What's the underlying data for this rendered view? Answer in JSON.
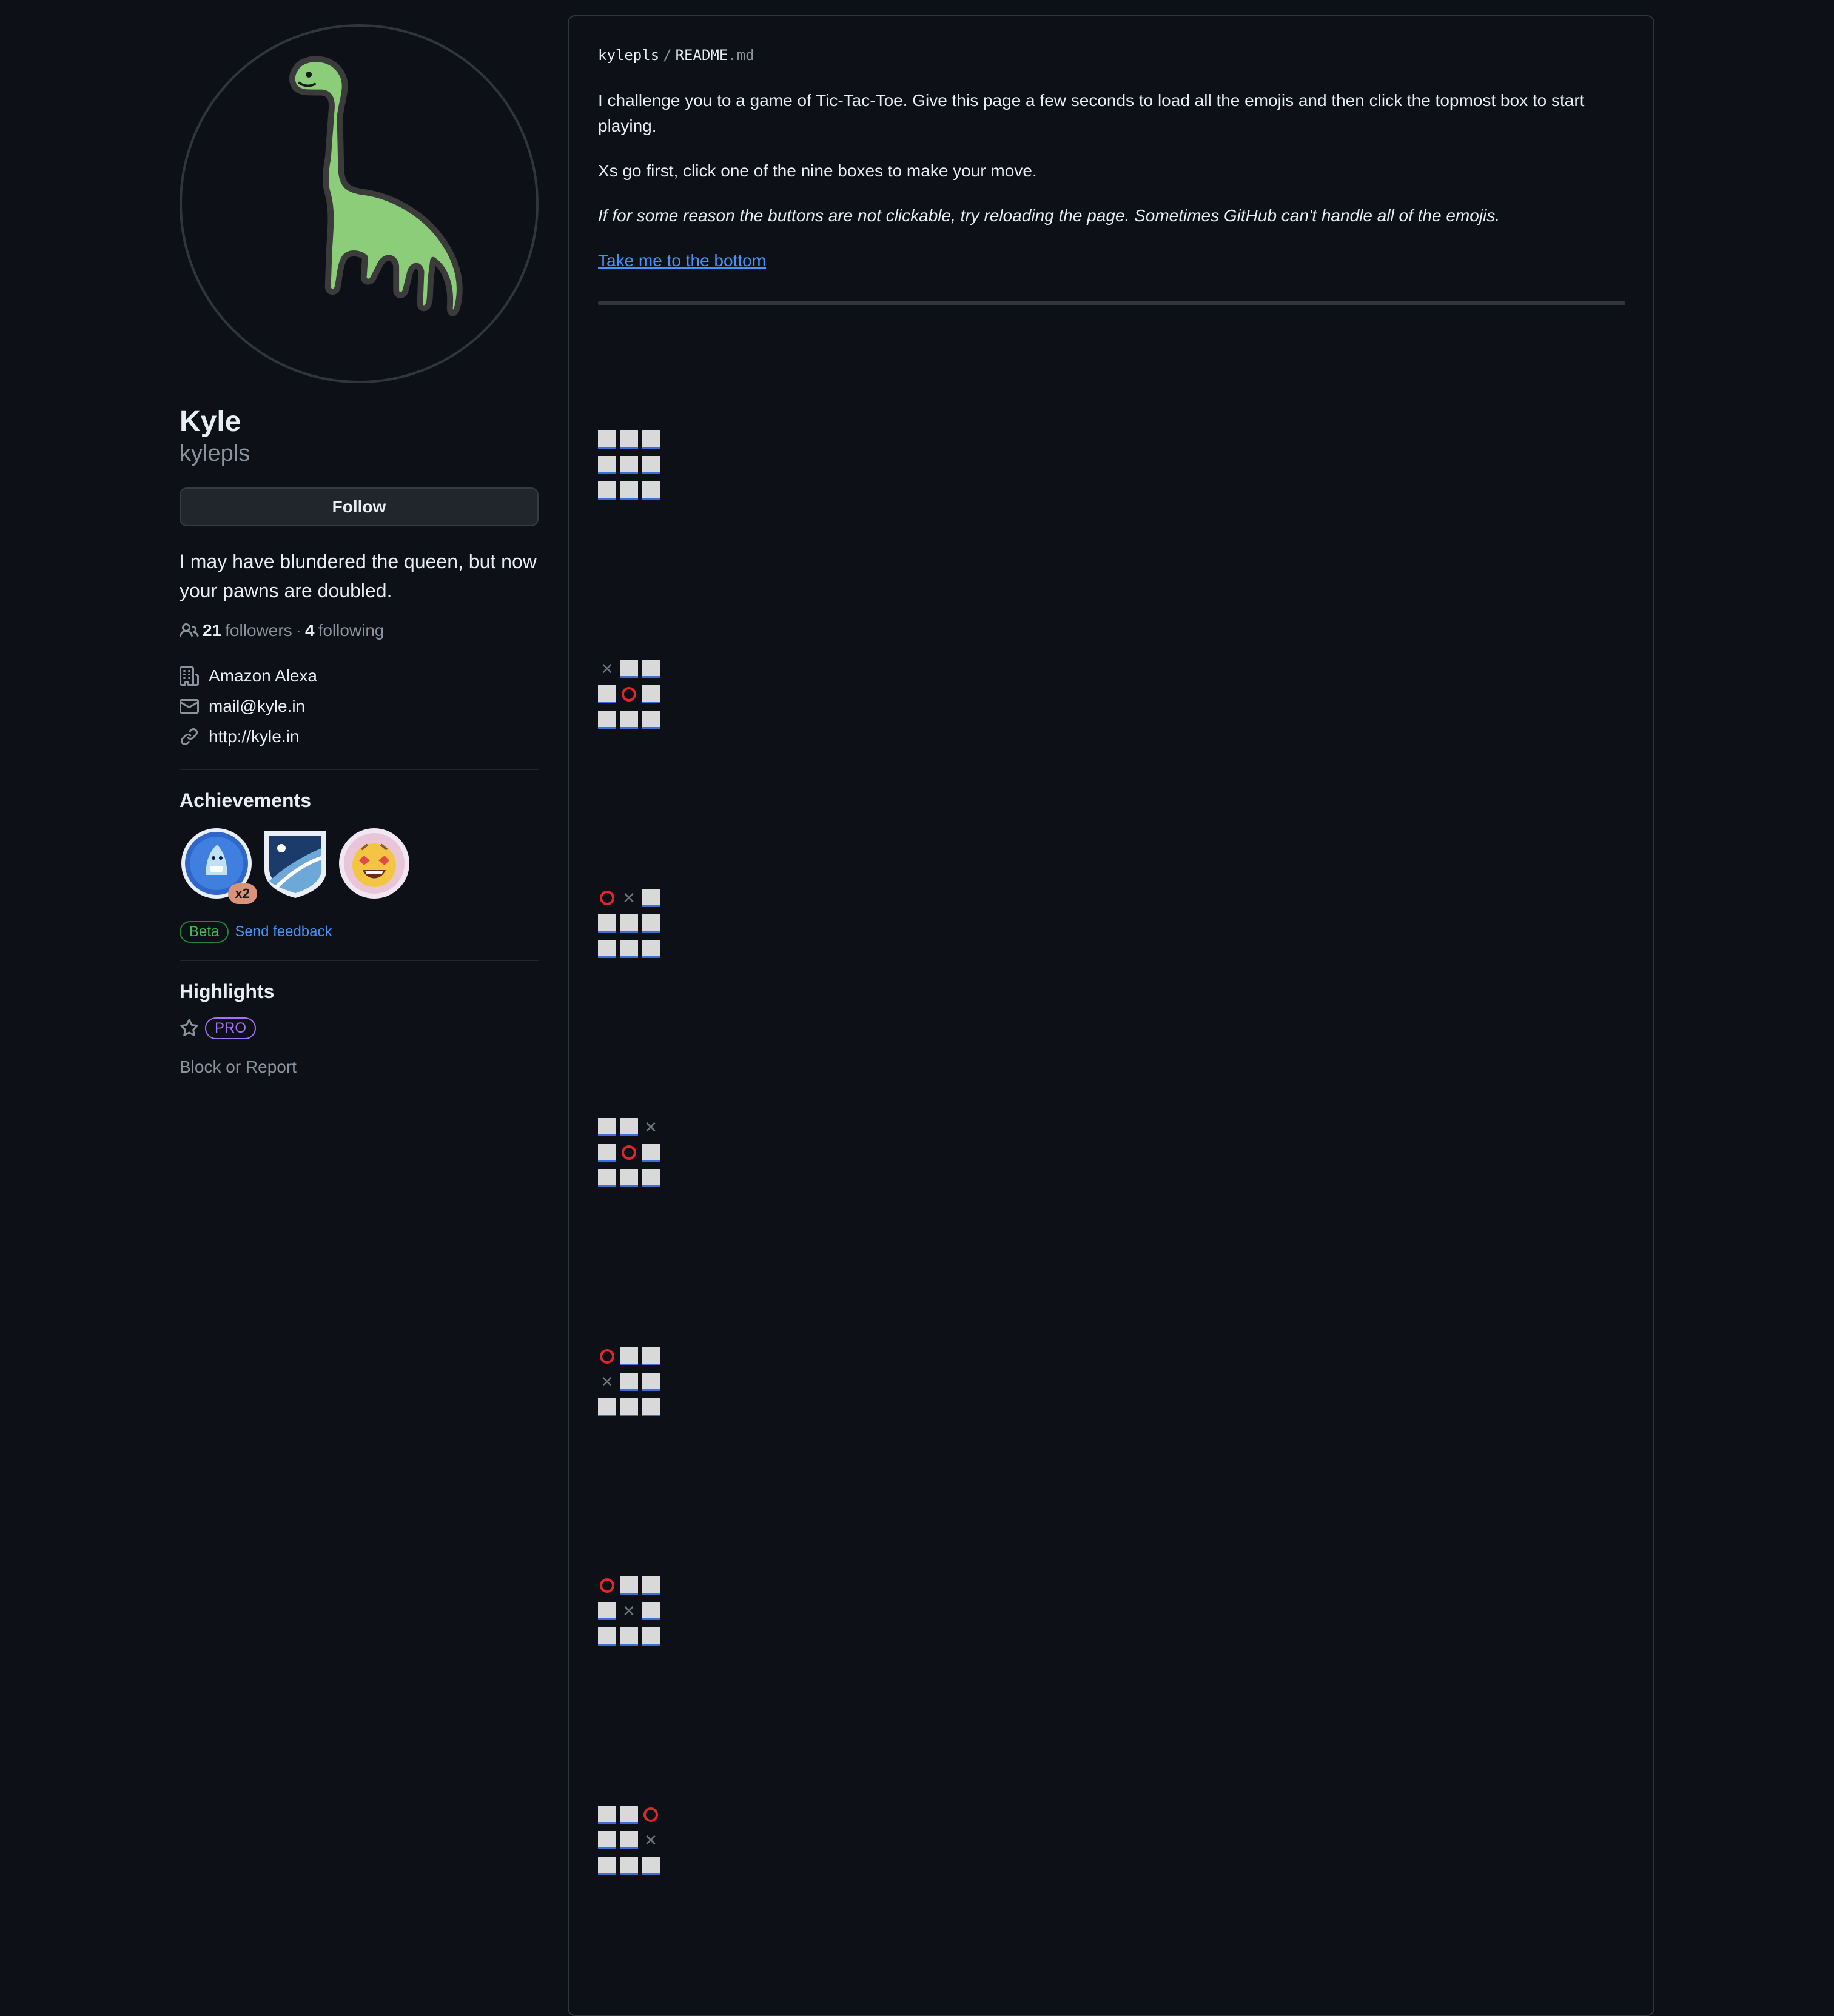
{
  "profile": {
    "display_name": "Kyle",
    "username": "kylepls",
    "follow_label": "Follow",
    "bio": "I may have blundered the queen, but now your pawns are doubled.",
    "followers_count": "21",
    "followers_label": "followers",
    "separator": "·",
    "following_count": "4",
    "following_label": "following",
    "company": "Amazon Alexa",
    "email": "mail@kyle.in",
    "website": "http://kyle.in"
  },
  "achievements": {
    "title": "Achievements",
    "badges": [
      {
        "icon": "shark-badge-icon",
        "count": "x2"
      },
      {
        "icon": "pull-shark-shield-icon"
      },
      {
        "icon": "starstruck-badge-icon"
      }
    ],
    "beta_label": "Beta",
    "feedback_label": "Send feedback"
  },
  "highlights": {
    "title": "Highlights",
    "pro_label": "PRO",
    "block_label": "Block or Report"
  },
  "readme": {
    "owner": "kylepls",
    "separator": "/",
    "filename": "README",
    "ext": ".md",
    "intro": "I challenge you to a game of Tic-Tac-Toe. Give this page a few seconds to load all the emojis and then click the topmost box to start playing.",
    "rules": "Xs go first, click one of the nine boxes to make your move.",
    "note": "If for some reason the buttons are not clickable, try reloading the page. Sometimes GitHub can't handle all of the emojis.",
    "bottom_link": "Take me to the bottom"
  },
  "boards": [
    [
      "",
      "",
      "",
      "",
      "",
      "",
      "",
      "",
      ""
    ],
    [
      "X",
      "",
      "",
      "",
      "O",
      "",
      "",
      "",
      ""
    ],
    [
      "O",
      "X",
      "",
      "",
      "",
      "",
      "",
      "",
      ""
    ],
    [
      "",
      "",
      "X",
      "",
      "O",
      "",
      "",
      "",
      ""
    ],
    [
      "O",
      "",
      "",
      "X",
      "",
      "",
      "",
      "",
      ""
    ],
    [
      "O",
      "",
      "",
      "",
      "X",
      "",
      "",
      "",
      ""
    ],
    [
      "",
      "",
      "O",
      "",
      "",
      "X",
      "",
      "",
      ""
    ]
  ],
  "colors": {
    "background": "#0d1117",
    "link": "#4493f8",
    "o_mark": "#e0262a",
    "x_mark": "#6e7681",
    "avatar_dino": "#8ccd7a"
  }
}
